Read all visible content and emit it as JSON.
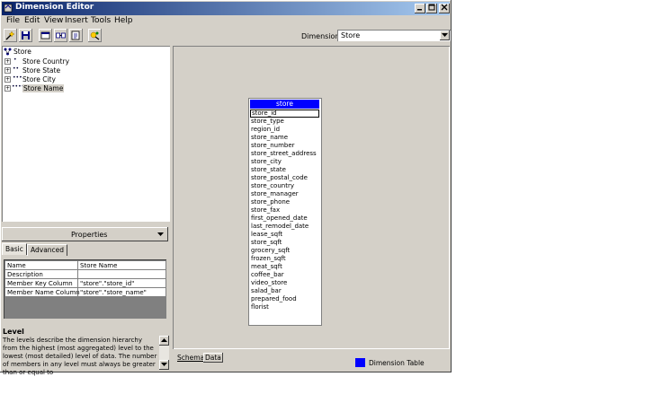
{
  "window": {
    "title": "Dimension Editor"
  },
  "menu": [
    "File",
    "Edit",
    "View",
    "Insert",
    "Tools",
    "Help"
  ],
  "toolbar": {
    "dimension_label": "Dimension:",
    "dimension_value": "Store"
  },
  "tree": {
    "root": "Store",
    "items": [
      {
        "label": "Store Country",
        "level": 1
      },
      {
        "label": "Store State",
        "level": 2
      },
      {
        "label": "Store City",
        "level": 3
      },
      {
        "label": "Store Name",
        "level": 4
      }
    ]
  },
  "properties": {
    "header": "Properties",
    "tabs": [
      "Basic",
      "Advanced"
    ],
    "rows": [
      {
        "name": "Name",
        "value": "Store Name"
      },
      {
        "name": "Description",
        "value": ""
      },
      {
        "name": "Member Key Column",
        "value": "\"store\".\"store_id\""
      },
      {
        "name": "Member Name Column",
        "value": "\"store\".\"store_name\""
      }
    ]
  },
  "level_help": {
    "title": "Level",
    "text": "The levels describe the dimension hierarchy from the highest (most aggregated) level to the lowest (most detailed) level of data. The number of members in any level must always be greater than or equal to"
  },
  "schema_table": {
    "name": "store",
    "fields": [
      "store_id",
      "store_type",
      "region_id",
      "store_name",
      "store_number",
      "store_street_address",
      "store_city",
      "store_state",
      "store_postal_code",
      "store_country",
      "store_manager",
      "store_phone",
      "store_fax",
      "first_opened_date",
      "last_remodel_date",
      "lease_sqft",
      "store_sqft",
      "grocery_sqft",
      "frozen_sqft",
      "meat_sqft",
      "coffee_bar",
      "video_store",
      "salad_bar",
      "prepared_food",
      "florist"
    ]
  },
  "bottom_tabs": [
    "Schema",
    "Data"
  ],
  "legend": {
    "label": "Dimension Table",
    "color": "#0000ff"
  }
}
